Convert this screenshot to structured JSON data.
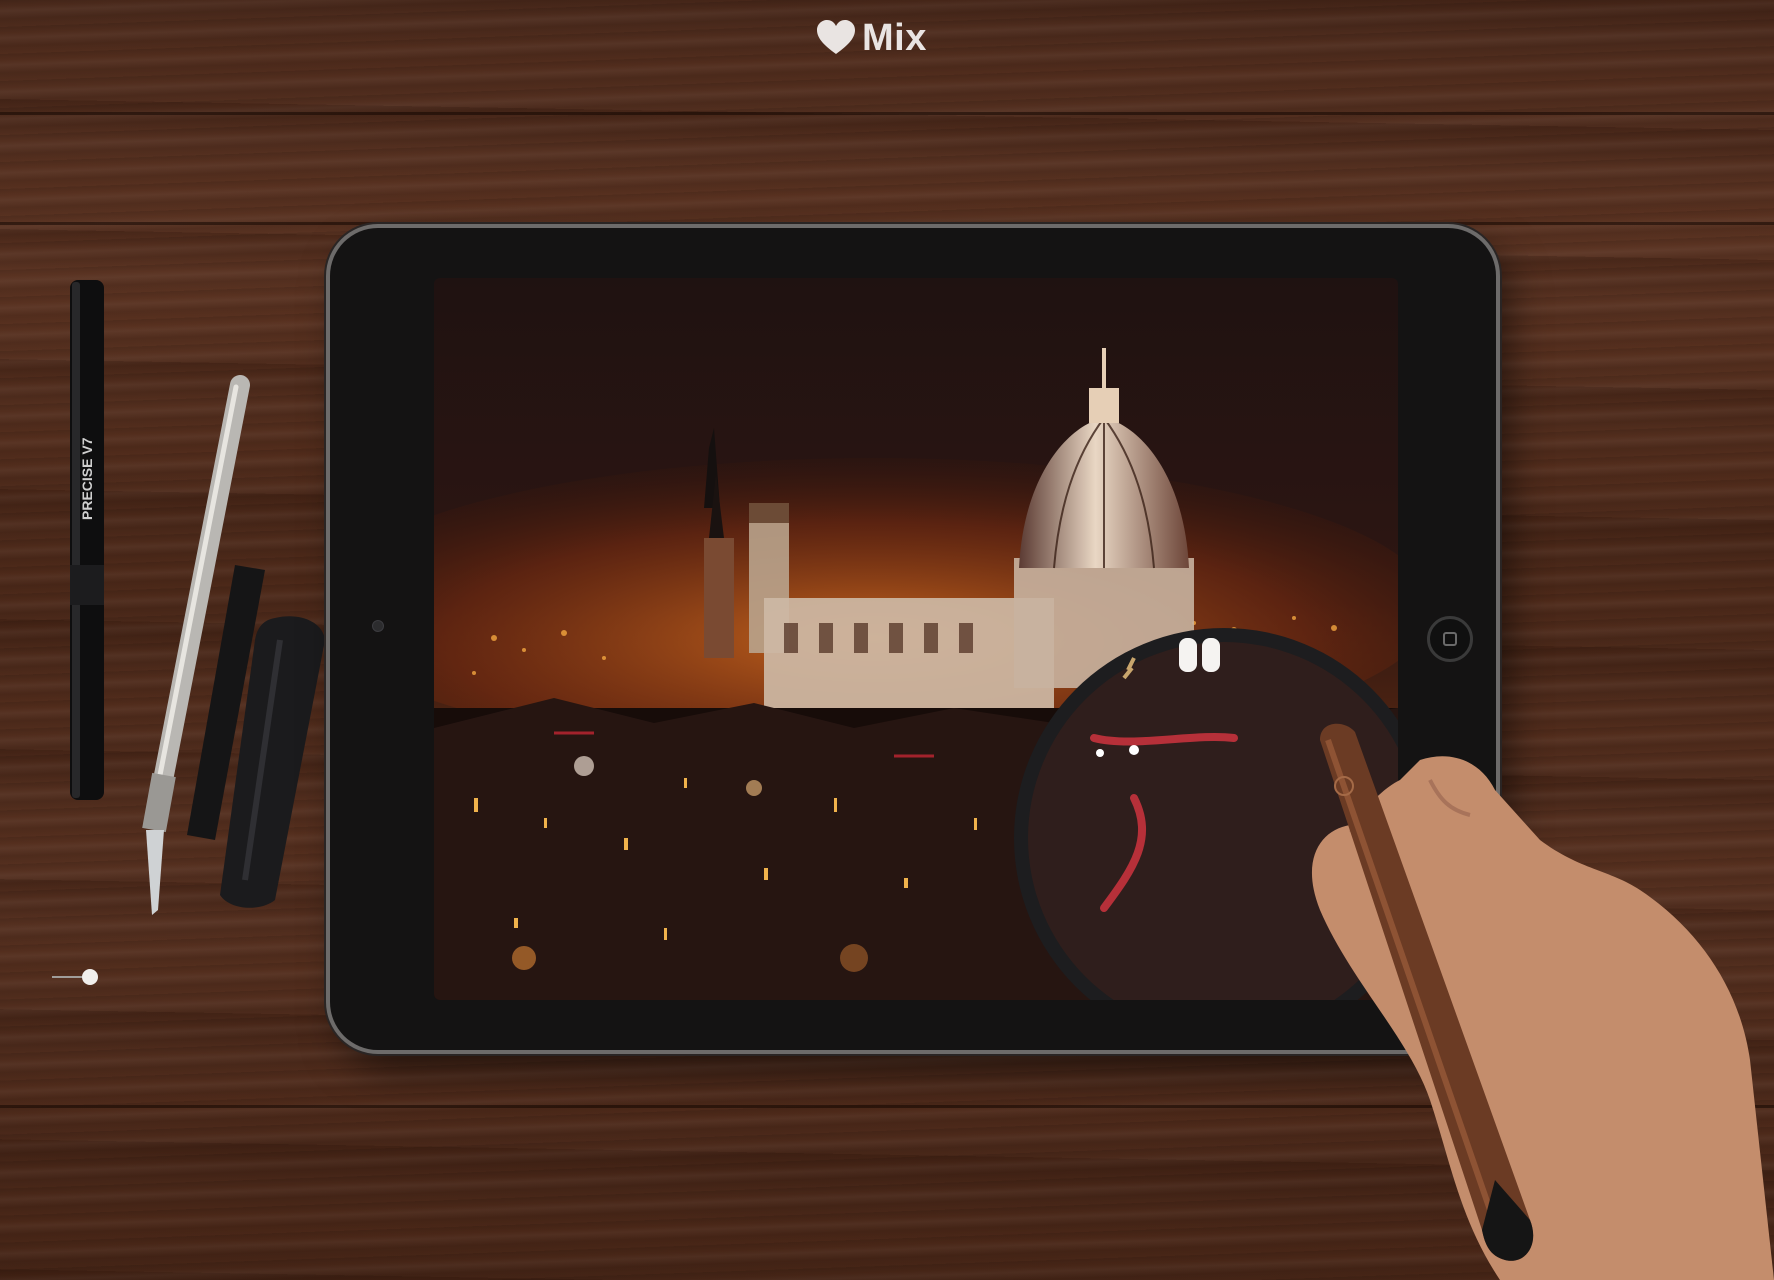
{
  "brand": {
    "name": "Mix",
    "logo_icon": "heart-icon",
    "text_color": "#e9e4e2"
  },
  "scene": {
    "surface": "wood-desk",
    "device": "tablet",
    "painting": "night-city-dome",
    "tools": [
      "marker-pen",
      "pencil",
      "hobby-knife",
      "charcoal-stick",
      "charcoal-block",
      "stylus"
    ],
    "pen_imprint": "PRECISE V7",
    "colors": {
      "wood": "#4f2c1d",
      "tablet_bezel": "#141313",
      "sky": "#2a1512",
      "glow_orange": "#e0721f",
      "dome_light": "#e9d7c4"
    }
  }
}
